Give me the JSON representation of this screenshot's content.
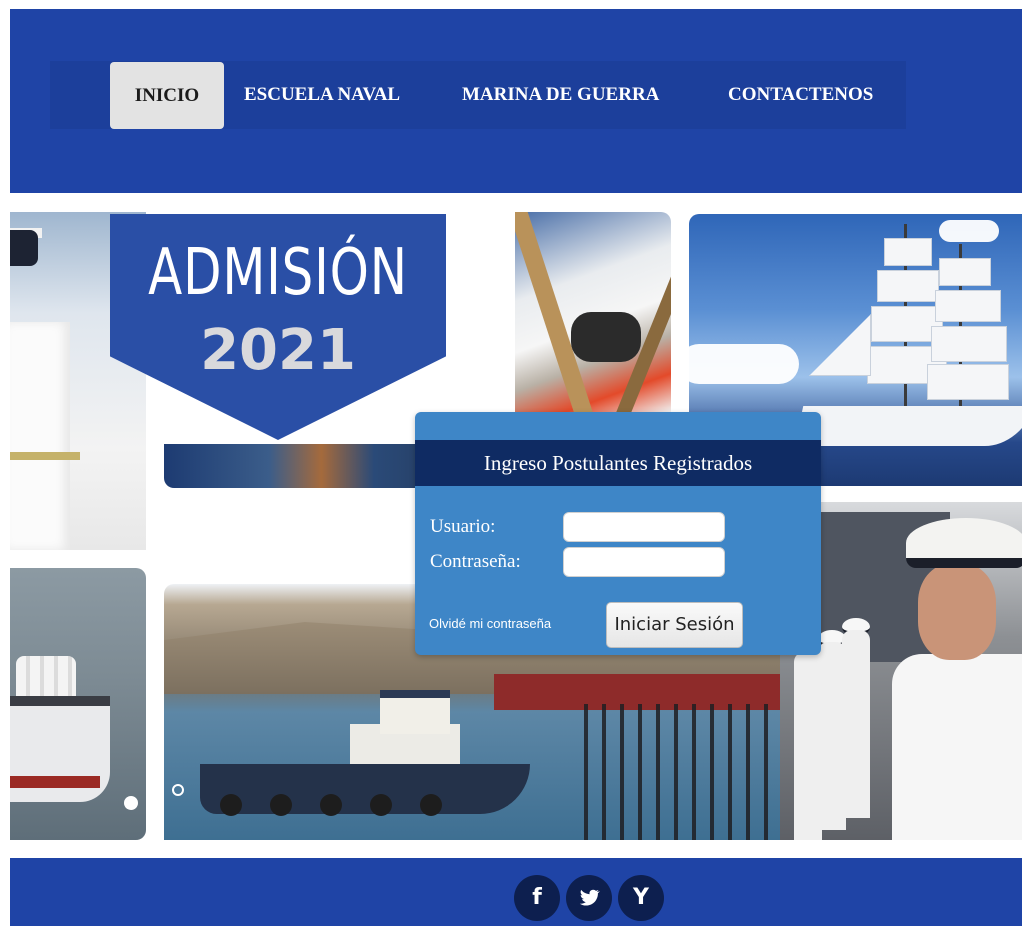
{
  "nav": {
    "items": [
      {
        "label": "INICIO"
      },
      {
        "label": "ESCUELA NAVAL"
      },
      {
        "label": "MARINA DE GUERRA"
      },
      {
        "label": "CONTACTENOS"
      }
    ],
    "active_index": 0
  },
  "banner": {
    "title": "ADMISIÓN",
    "year": "2021"
  },
  "login": {
    "heading": "Ingreso Postulantes Registrados",
    "user_label": "Usuario:",
    "user_value": "",
    "password_label": "Contraseña:",
    "password_value": "",
    "forgot_link": "Olvidé mi contraseña",
    "submit_label": "Iniciar Sesión"
  },
  "social": {
    "facebook": "f",
    "twitter": "twitter-icon",
    "youtube": "Y"
  },
  "colors": {
    "brand_blue": "#1f44a6",
    "panel_blue": "#3e86c7",
    "panel_header": "#0f2b63",
    "social_bg": "#0d1f4f"
  }
}
